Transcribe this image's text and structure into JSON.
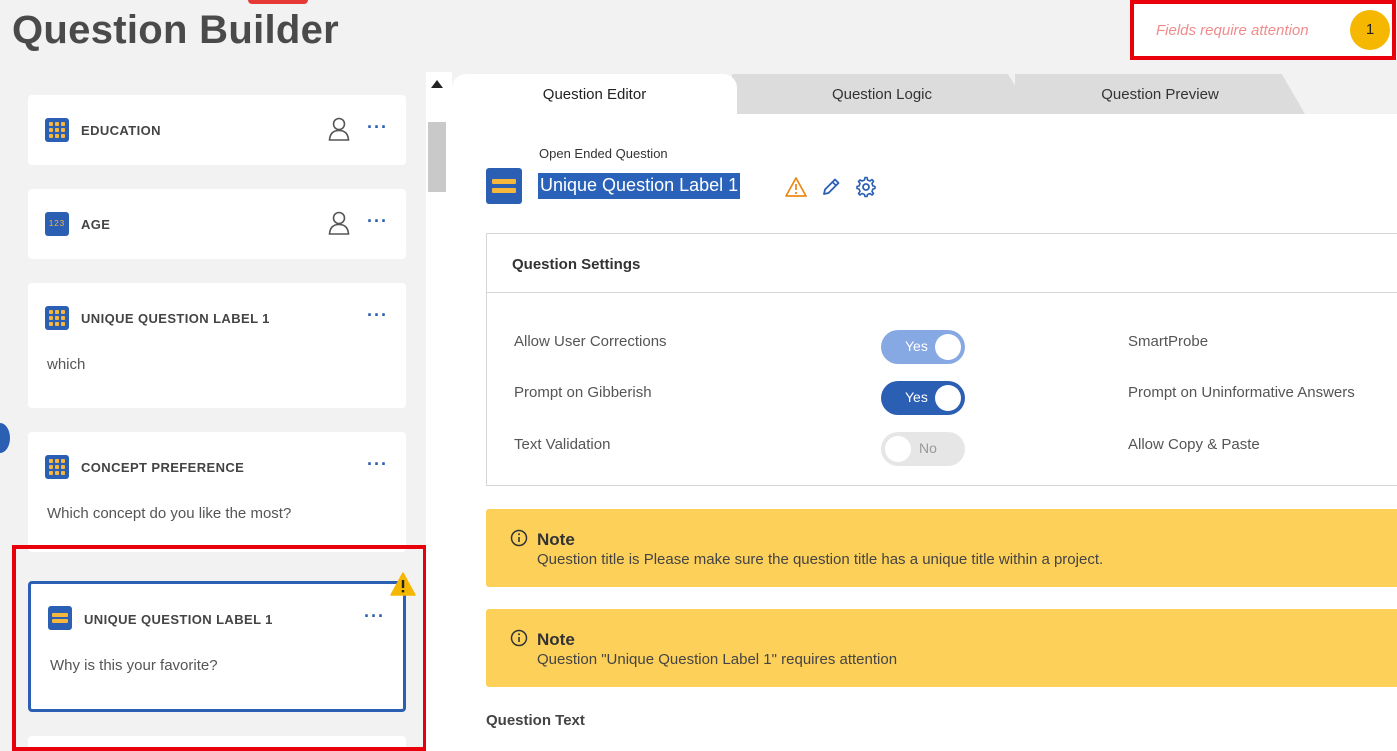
{
  "header": {
    "title": "Question Builder",
    "attention_text": "Fields require attention",
    "attention_count": "1"
  },
  "sidebar": {
    "cards": [
      {
        "label": "EDUCATION",
        "body": "",
        "icon": "grid-icon"
      },
      {
        "label": "AGE",
        "body": "",
        "icon": "numeric-icon"
      },
      {
        "label": "UNIQUE QUESTION LABEL 1",
        "body": "which",
        "icon": "grid-icon"
      },
      {
        "label": "CONCEPT PREFERENCE",
        "body": "Which concept do you like the most?",
        "icon": "grid-icon"
      },
      {
        "label": "UNIQUE QUESTION LABEL 1",
        "body": "Why is this your favorite?",
        "icon": "open-ended-icon"
      }
    ],
    "more_glyph": "···"
  },
  "tabs": [
    {
      "label": "Question Editor",
      "active": true
    },
    {
      "label": "Question Logic",
      "active": false
    },
    {
      "label": "Question Preview",
      "active": false
    }
  ],
  "editor": {
    "question_type": "Open Ended Question",
    "question_label": "Unique Question Label 1",
    "settings_title": "Question Settings",
    "settings": [
      {
        "label": "Allow User Corrections",
        "toggle": "Yes",
        "right_label": "SmartProbe"
      },
      {
        "label": "Prompt on Gibberish",
        "toggle": "Yes",
        "right_label": "Prompt on Uninformative Answers"
      },
      {
        "label": "Text Validation",
        "toggle": "No",
        "right_label": "Allow Copy & Paste"
      }
    ],
    "notes": [
      {
        "title": "Note",
        "text": "Question title is Please make sure the question title has a unique title within a project."
      },
      {
        "title": "Note",
        "text": "Question \"Unique Question Label 1\" requires attention"
      }
    ],
    "question_text_label": "Question Text"
  },
  "colors": {
    "accent": "#2b5fb4",
    "warning": "#f5b700",
    "note_bg": "#fdd05a",
    "highlight_red": "#e8000b"
  }
}
